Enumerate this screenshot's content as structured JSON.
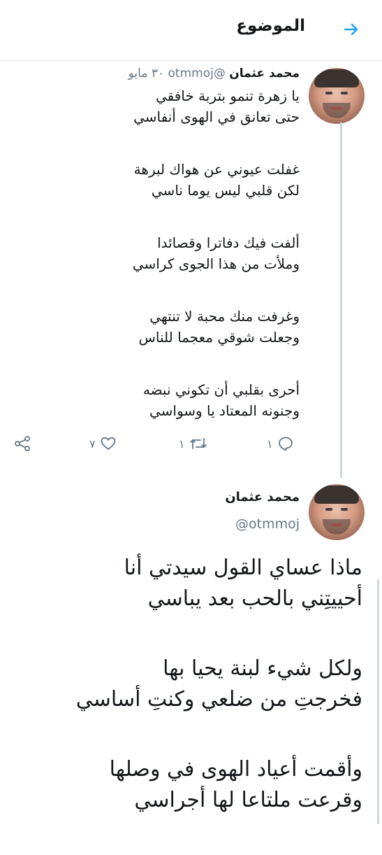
{
  "header": {
    "title": "الموضوع",
    "back_icon": "arrow-right-icon",
    "accent_color": "#1da1f2"
  },
  "tweet1": {
    "author_name": "محمد عثمان",
    "handle": "@otmmoj",
    "date": "٣٠ مايو",
    "stanzas": [
      [
        "يا زهرة تنمو بتربة خافقي",
        "حتى تعانق في الهوى أنفاسي"
      ],
      [
        "غفلت عيوني عن هواك لبرهة",
        "لكن قلبي ليس يوما ناسي"
      ],
      [
        "ألفت فيك دفاترا وقصائدا",
        "وملأت من هذا الجوى كراسي"
      ],
      [
        "وغرفت منك محبة لا تنتهي",
        "وجعلت شوقي معجما للناس"
      ],
      [
        "أحرى بقلبي أن تكوني نبضه",
        "وجنونه المعتاد يا وسواسي"
      ]
    ],
    "actions": {
      "reply_count": "١",
      "retweet_count": "١",
      "like_count": "٧"
    }
  },
  "tweet2": {
    "author_name": "محمد عثمان",
    "handle": "@otmmoj",
    "stanzas": [
      [
        "ماذا عساي القول سيدتي أنا",
        "أحييتِني بالحب بعد يباسي"
      ],
      [
        "ولكل شيء لبنة يحيا بها",
        "فخرجتِ من ضلعي وكنتِ أساسي"
      ],
      [
        "وأقمت أعياد الهوى في وصلها",
        "وقرعت ملتاعا لها أجراسي"
      ]
    ]
  }
}
